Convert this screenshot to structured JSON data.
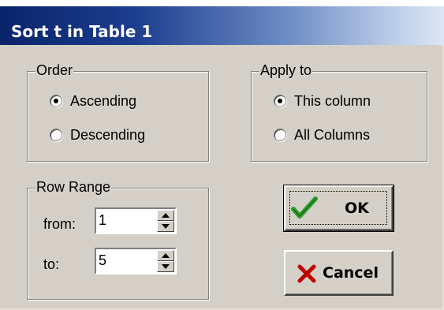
{
  "window": {
    "title": "Sort t in Table 1"
  },
  "order": {
    "legend": "Order",
    "options": [
      {
        "label": "Ascending",
        "selected": true
      },
      {
        "label": "Descending",
        "selected": false
      }
    ]
  },
  "apply_to": {
    "legend": "Apply to",
    "options": [
      {
        "label": "This column",
        "selected": true
      },
      {
        "label": "All Columns",
        "selected": false
      }
    ]
  },
  "row_range": {
    "legend": "Row Range",
    "from_label": "from:",
    "from_value": "1",
    "to_label": "to:",
    "to_value": "5"
  },
  "buttons": {
    "ok_label": "OK",
    "ok_icon": "check-icon",
    "cancel_label": "Cancel",
    "cancel_icon": "x-icon"
  },
  "colors": {
    "dialog_face": "#d4d0c8",
    "title_bar": "#0a246a",
    "check_green": "#2e9e2e",
    "cancel_red": "#c00000"
  }
}
